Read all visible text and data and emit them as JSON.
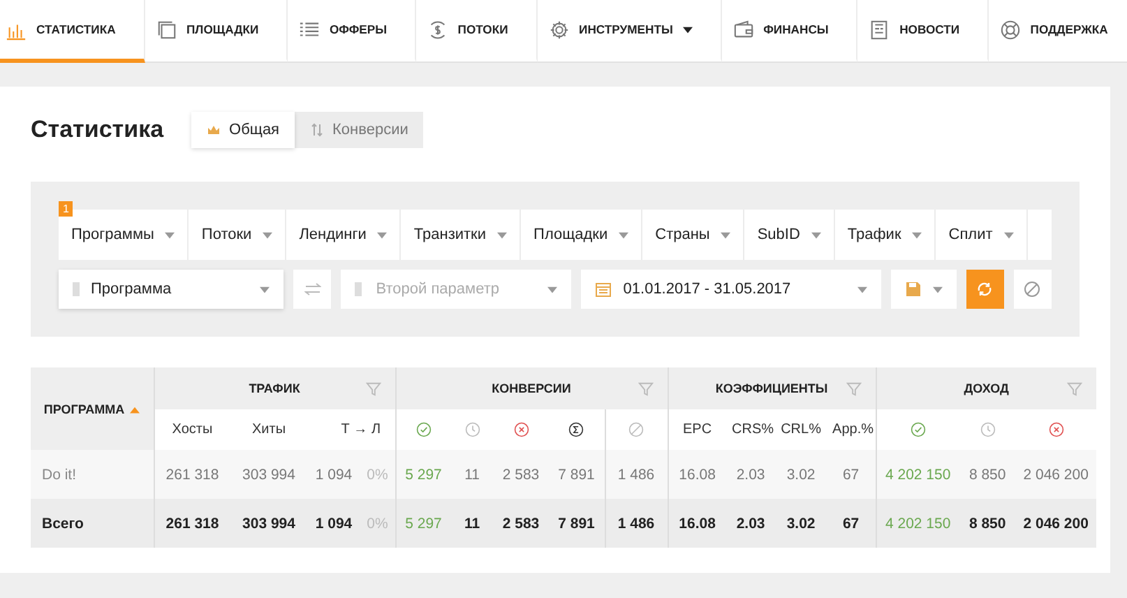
{
  "nav": [
    {
      "kind": "chart",
      "label": "СТАТИСТИКА",
      "selected": true
    },
    {
      "kind": "pages",
      "label": "ПЛОЩАДКИ",
      "selected": false
    },
    {
      "kind": "list",
      "label": "ОФФЕРЫ",
      "selected": false
    },
    {
      "kind": "coin",
      "label": "ПОТОКИ",
      "selected": false
    },
    {
      "kind": "gear",
      "label": "ИНСТРУМЕНТЫ",
      "selected": false,
      "dropdown": true
    },
    {
      "kind": "wallet",
      "label": "ФИНАНСЫ",
      "selected": false
    },
    {
      "kind": "news",
      "label": "НОВОСТИ",
      "selected": false
    },
    {
      "kind": "support",
      "label": "ПОДДЕРЖКА",
      "selected": false
    }
  ],
  "page_title": "Статистика",
  "view_tabs": [
    {
      "kind": "crown",
      "label": "Общая",
      "selected": true
    },
    {
      "kind": "sort",
      "label": "Конверсии",
      "selected": false
    }
  ],
  "filter_tabs": [
    {
      "label": "Программы",
      "badge": "1"
    },
    {
      "label": "Потоки"
    },
    {
      "label": "Лендинги"
    },
    {
      "label": "Транзитки"
    },
    {
      "label": "Площадки"
    },
    {
      "label": "Страны"
    },
    {
      "label": "SubID"
    },
    {
      "label": "Трафик"
    },
    {
      "label": "Сплит"
    }
  ],
  "first_param": {
    "value": "Программа"
  },
  "second_param": {
    "placeholder": "Второй параметр"
  },
  "date_range": {
    "value": "01.01.2017 - 31.05.2017"
  },
  "table": {
    "sort_column": {
      "label": "ПРОГРАММА",
      "ascending": true
    },
    "groups": [
      {
        "title": "ТРАФИК",
        "columns": [
          {
            "kind": "text",
            "label": "Хосты"
          },
          {
            "kind": "text",
            "label": "Хиты"
          },
          {
            "kind": "ratio",
            "label": "Т → Л"
          }
        ]
      },
      {
        "title": "КОНВЕРСИИ",
        "columns": [
          {
            "kind": "check"
          },
          {
            "kind": "clock"
          },
          {
            "kind": "cross"
          },
          {
            "kind": "sigma"
          },
          {
            "kind": "blocked"
          }
        ]
      },
      {
        "title": "КОЭФФИЦИЕНТЫ",
        "columns": [
          {
            "kind": "text",
            "label": "EPC"
          },
          {
            "kind": "text",
            "label": "CRS%"
          },
          {
            "kind": "text",
            "label": "CRL%"
          },
          {
            "kind": "text",
            "label": "App.%"
          }
        ]
      },
      {
        "title": "ДОХОД",
        "columns": [
          {
            "kind": "check"
          },
          {
            "kind": "clock"
          },
          {
            "kind": "cross"
          }
        ]
      }
    ],
    "rows": [
      {
        "kind": "data",
        "cells": [
          {
            "text": "Do it!"
          },
          {
            "text": "261 318"
          },
          {
            "text": "303 994"
          },
          {
            "text": "1 094"
          },
          {
            "text": "0%",
            "muted": true
          },
          {
            "text": "5 297",
            "approved": true
          },
          {
            "text": "11"
          },
          {
            "text": "2 583"
          },
          {
            "text": "7 891"
          },
          {
            "text": "1 486"
          },
          {
            "text": "16.08"
          },
          {
            "text": "2.03"
          },
          {
            "text": "3.02"
          },
          {
            "text": "67"
          },
          {
            "text": "4 202 150",
            "approved": true
          },
          {
            "text": "8 850"
          },
          {
            "text": "2 046 200"
          }
        ]
      },
      {
        "kind": "total",
        "cells": [
          {
            "text": "Всего"
          },
          {
            "text": "261 318"
          },
          {
            "text": "303 994"
          },
          {
            "text": "1 094"
          },
          {
            "text": "0%",
            "muted": true
          },
          {
            "text": "5 297",
            "approved": true
          },
          {
            "text": "11"
          },
          {
            "text": "2 583"
          },
          {
            "text": "7 891"
          },
          {
            "text": "1 486"
          },
          {
            "text": "16.08"
          },
          {
            "text": "2.03"
          },
          {
            "text": "3.02"
          },
          {
            "text": "67"
          },
          {
            "text": "4 202 150",
            "approved": true
          },
          {
            "text": "8 850"
          },
          {
            "text": "2 046 200"
          }
        ]
      }
    ]
  }
}
